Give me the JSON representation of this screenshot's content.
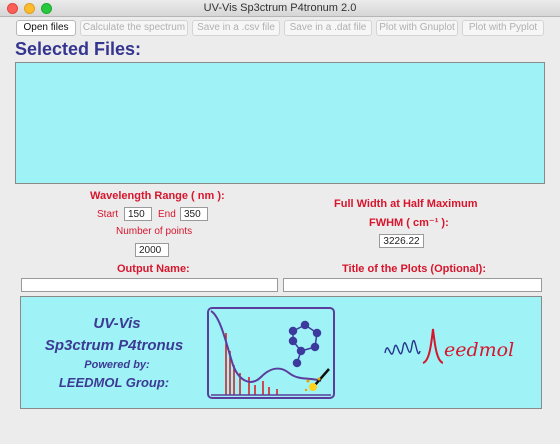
{
  "window": {
    "title": "UV-Vis Sp3ctrum P4tronum 2.0"
  },
  "toolbar": {
    "open_files": "Open files",
    "calculate": "Calculate the spectrum",
    "save_csv": "Save in a .csv file",
    "save_dat": "Save in a .dat file",
    "plot_gnuplot": "Plot with Gnuplot",
    "plot_pyplot": "Plot with Pyplot"
  },
  "files": {
    "heading": "Selected Files:"
  },
  "wavelength": {
    "heading": "Wavelength Range ( nm ):",
    "start_label": "Start",
    "start_value": "150",
    "end_label": "End",
    "end_value": "350",
    "points_label": "Number of points",
    "points_value": "2000"
  },
  "fwhm": {
    "heading_line1": "Full Width at Half Maximum",
    "heading_line2": "FWHM ( cm⁻¹ ):",
    "value": "3226.22"
  },
  "output": {
    "label": "Output Name:",
    "value": ""
  },
  "plot_title": {
    "label": "Title of the Plots (Optional):",
    "value": ""
  },
  "banner": {
    "line1": "UV-Vis",
    "line2": "Sp3ctrum P4tronus",
    "line3": "Powered by:",
    "line4": "LEEDMOL Group:",
    "logo_text": "eedmol"
  },
  "colors": {
    "accent_red": "#d7152d",
    "heading_blue": "#35358f",
    "panel_cyan": "#9ff3f6"
  }
}
